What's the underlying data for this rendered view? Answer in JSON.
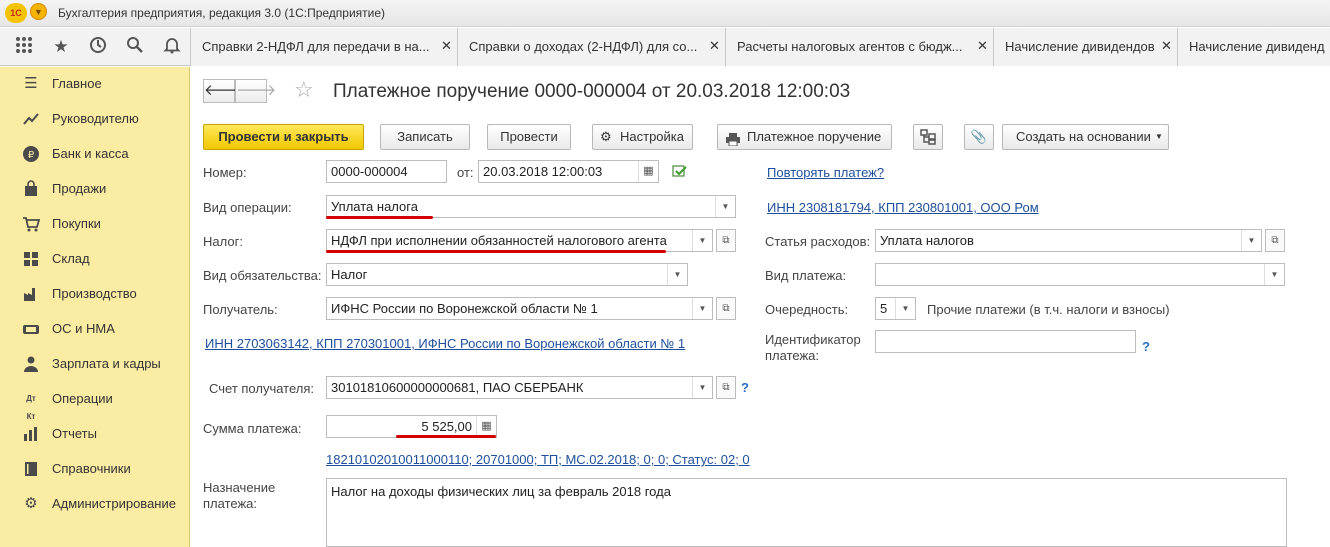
{
  "app": {
    "logo": "1С",
    "title": "Бухгалтерия предприятия, редакция 3.0  (1С:Предприятие)"
  },
  "toolbar_icons": [
    "apps-grid-icon",
    "favorites-star-icon",
    "history-icon",
    "search-icon",
    "notifications-bell-icon"
  ],
  "tabs": [
    {
      "label": "Справки 2-НДФЛ для передачи в на..."
    },
    {
      "label": "Справки о доходах (2-НДФЛ) для со..."
    },
    {
      "label": "Расчеты налоговых агентов с бюдж..."
    },
    {
      "label": "Начисление дивидендов"
    },
    {
      "label": "Начисление дивиденд"
    }
  ],
  "sidebar": {
    "items": [
      {
        "label": "Главное",
        "icon": "menu-lines-icon"
      },
      {
        "label": "Руководителю",
        "icon": "trend-chart-icon"
      },
      {
        "label": "Банк и касса",
        "icon": "ruble-coin-icon"
      },
      {
        "label": "Продажи",
        "icon": "shopping-bag-icon"
      },
      {
        "label": "Покупки",
        "icon": "cart-icon"
      },
      {
        "label": "Склад",
        "icon": "warehouse-icon"
      },
      {
        "label": "Производство",
        "icon": "factory-gear-icon"
      },
      {
        "label": "ОС и НМА",
        "icon": "assets-icon"
      },
      {
        "label": "Зарплата и кадры",
        "icon": "person-icon"
      },
      {
        "label": "Операции",
        "icon": "debit-credit-icon"
      },
      {
        "label": "Отчеты",
        "icon": "bar-chart-icon"
      },
      {
        "label": "Справочники",
        "icon": "book-icon"
      },
      {
        "label": "Администрирование",
        "icon": "settings-gear-icon"
      }
    ]
  },
  "form": {
    "title": "Платежное поручение 0000-000004 от 20.03.2018 12:00:03",
    "buttons": {
      "post_close": "Провести и закрыть",
      "write": "Записать",
      "post": "Провести",
      "settings": "Настройка",
      "print": "Платежное поручение",
      "create_based": "Создать на основании"
    },
    "number_label": "Номер:",
    "number_value": "0000-000004",
    "from_label": "от:",
    "date_value": "20.03.2018 12:00:03",
    "repeat_link": "Повторять платеж?",
    "operation_label": "Вид операции:",
    "operation_value": "Уплата налога",
    "org_link": "ИНН 2308181794, КПП 230801001, ООО Ром",
    "tax_label": "Налог:",
    "tax_value": "НДФЛ при исполнении обязанностей налогового агента",
    "expense_label": "Статья расходов:",
    "expense_value": "Уплата налогов",
    "obligation_label": "Вид обязательства:",
    "obligation_value": "Налог",
    "payment_type_label": "Вид платежа:",
    "payment_type_value": "",
    "recipient_label": "Получатель:",
    "recipient_value": "ИФНС России по Воронежской области № 1",
    "priority_label": "Очередность:",
    "priority_value": "5",
    "priority_desc": "Прочие платежи (в т.ч. налоги и взносы)",
    "recipient_link": "ИНН 2703063142, КПП 270301001, ИФНС России по Воронежской области № 1",
    "identifier_label_1": "Идентификатор",
    "identifier_label_2": "платежа:",
    "identifier_value": "",
    "help_mark": "?",
    "account_label": "Счет получателя:",
    "account_value": "30101810600000000681, ПАО СБЕРБАНК",
    "amount_label": "Сумма платежа:",
    "amount_value": "5 525,00",
    "kbk_link": "18210102010011000110; 20701000; ТП; МС.02.2018; 0; 0; Статус: 02; 0",
    "purpose_label_1": "Назначение",
    "purpose_label_2": "платежа:",
    "purpose_value": "Налог на доходы физических лиц за февраль 2018 года"
  }
}
